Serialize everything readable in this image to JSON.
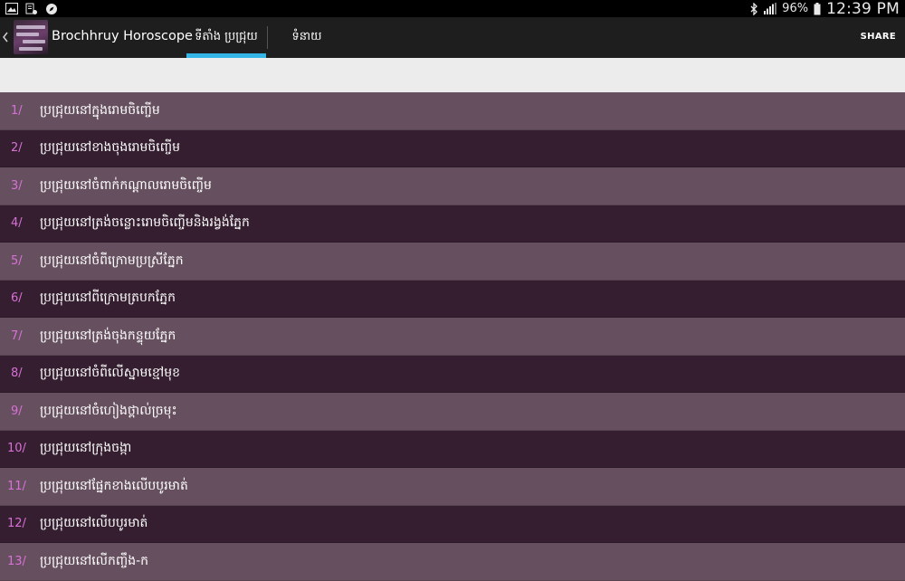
{
  "status_bar": {
    "battery": "96%",
    "time": "12:39 PM",
    "left_icons": [
      "image-icon",
      "settings-doc-icon",
      "compass-icon"
    ],
    "right_icons": [
      "bluetooth-icon",
      "signal-icon",
      "battery-icon"
    ]
  },
  "action_bar": {
    "title": "Brochhruy Horoscope",
    "tabs": [
      {
        "label": "ទីតាំង ប្រជ្រុយ",
        "selected": true
      },
      {
        "label": "ទំនាយ",
        "selected": false
      }
    ],
    "share_label": "SHARE",
    "accent_color": "#33b5e5"
  },
  "list": {
    "items": [
      {
        "number": "1/",
        "label": "ប្រជ្រុយនៅក្នុងរោមចិញ្ចើម"
      },
      {
        "number": "2/",
        "label": "ប្រជ្រុយនៅខាងចុងរោមចិញ្ចើម"
      },
      {
        "number": "3/",
        "label": "ប្រជ្រុយនៅចំពាក់កណ្ដាលរោមចិញ្ចើម"
      },
      {
        "number": "4/",
        "label": "ប្រជ្រុយនៅត្រង់ចន្លោះរោមចិញ្ចើមនិងរង្វង់ភ្នែក"
      },
      {
        "number": "5/",
        "label": "ប្រជ្រុយនៅចំពីក្រោមប្រស្រីភ្នែក"
      },
      {
        "number": "6/",
        "label": "ប្រជ្រុយនៅពីក្រោមត្របកភ្នែក"
      },
      {
        "number": "7/",
        "label": "ប្រជ្រុយនៅត្រង់ចុងកន្ទុយភ្នែក"
      },
      {
        "number": "8/",
        "label": "ប្រជ្រុយនៅចំពីលើស្នាមខ្មៅមុខ"
      },
      {
        "number": "9/",
        "label": "ប្រជ្រុយនៅចំហៀងថ្ពាល់ច្រមុះ"
      },
      {
        "number": "10/",
        "label": "ប្រជ្រុយនៅក្រុងចង្កា"
      },
      {
        "number": "11/",
        "label": "ប្រជ្រុយនៅផ្នែកខាងលើបបូរមាត់"
      },
      {
        "number": "12/",
        "label": "ប្រជ្រុយនៅលើបបូរមាត់"
      },
      {
        "number": "13/",
        "label": "ប្រជ្រុយនៅលើកញ្ចឹង-ក"
      }
    ],
    "row_colors": {
      "light": "#66505f",
      "dark": "#341e2f",
      "number": "#d870d8"
    }
  }
}
